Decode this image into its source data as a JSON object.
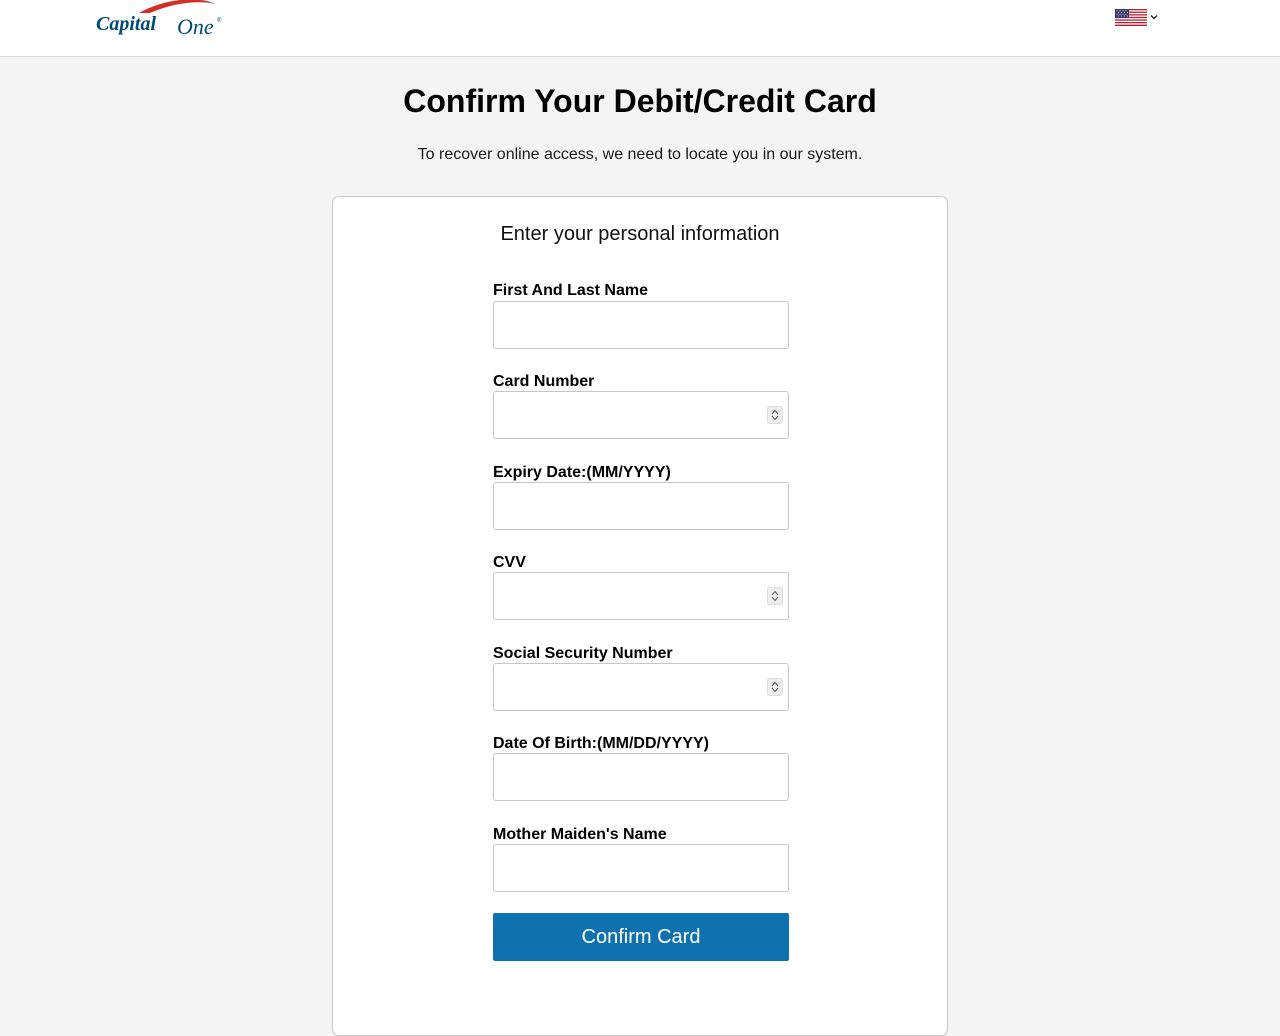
{
  "header": {
    "logo_text": "CapitalOne",
    "logo_icon": "capital-one-swoosh",
    "language_icon": "us-flag-icon"
  },
  "page": {
    "title": "Confirm Your Debit/Credit Card",
    "subtitle": "To recover online access, we need to locate you in our system."
  },
  "form": {
    "heading": "Enter your personal information",
    "fields": [
      {
        "label": "First And Last Name",
        "value": "",
        "type": "text"
      },
      {
        "label": "Card Number",
        "value": "",
        "type": "number"
      },
      {
        "label": "Expiry Date:(MM/YYYY)",
        "value": "",
        "type": "text"
      },
      {
        "label": "CVV",
        "value": "",
        "type": "number"
      },
      {
        "label": "Social Security Number",
        "value": "",
        "type": "number"
      },
      {
        "label": "Date Of Birth:(MM/DD/YYYY)",
        "value": "",
        "type": "text"
      },
      {
        "label": "Mother Maiden's Name",
        "value": "",
        "type": "text"
      }
    ],
    "submit_label": "Confirm Card"
  },
  "colors": {
    "brand_navy": "#004977",
    "brand_red": "#d03027",
    "button_blue": "#0f72ae",
    "page_bg": "#f4f4f4"
  }
}
